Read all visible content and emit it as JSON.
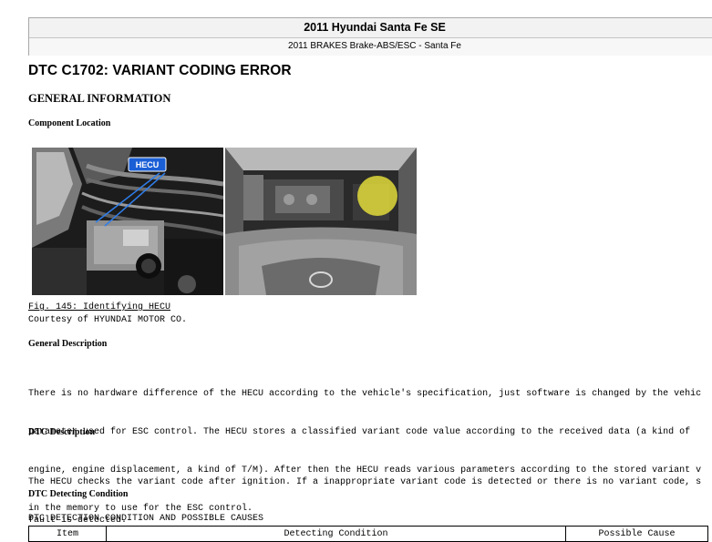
{
  "header": {
    "title": "2011 Hyundai Santa Fe SE",
    "subtitle": "2011 BRAKES Brake-ABS/ESC - Santa Fe"
  },
  "page_title": "DTC C1702: VARIANT CODING ERROR",
  "general_information": "GENERAL INFORMATION",
  "component_location": {
    "heading": "Component Location",
    "callout_label": "HECU",
    "figure_caption": "Fig. 145: Identifying HECU",
    "courtesy": "Courtesy of HYUNDAI MOTOR CO."
  },
  "general_description": {
    "heading": "General Description",
    "lines": [
      "There is no hardware difference of the HECU according to the vehicle's specification, just software is changed by the vehic",
      "parameter used for ESC control. The HECU stores a classified variant code value according to the received data (a kind of",
      "engine, engine displacement, a kind of T/M). After then the HECU reads various parameters according to the stored variant v",
      "in the memory to use for the ESC control."
    ]
  },
  "dtc_description": {
    "heading": "DTC Description",
    "lines": [
      "The HECU checks the variant code after ignition. If a inappropriate variant code is detected or there is no variant code, s",
      "fault is detected."
    ]
  },
  "dtc_detecting_condition": {
    "heading": "DTC Detecting Condition",
    "table_title": "DTC DETECTION CONDITION AND POSSIBLE CAUSES",
    "columns": [
      "Item",
      "Detecting Condition",
      "Possible Cause"
    ]
  },
  "colors": {
    "callout_blue": "#1b5fd6",
    "highlight_yellow": "#e8e23a",
    "header_bg": "#f2f2f2"
  }
}
